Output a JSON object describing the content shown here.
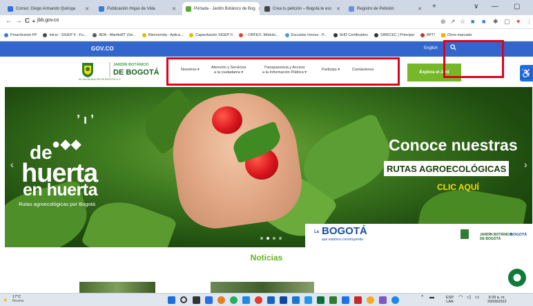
{
  "browser": {
    "tabs": [
      {
        "label": "Correo: Diego Armando Quiroga",
        "color": "#2f6fe0"
      },
      {
        "label": "Publicación Hojas de Vida",
        "color": "#3c7bd6"
      },
      {
        "label": "Portada - Jardín Botánico de Bog",
        "color": "#5ca832"
      },
      {
        "label": "Crea tu petición – Bogotá te esc",
        "color": "#444444"
      },
      {
        "label": "Registro de Petición",
        "color": "#6d8fd9"
      }
    ],
    "new_tab": "+",
    "window_controls": {
      "minimize": "—",
      "maximize": "▢",
      "close": "✕",
      "dropdown": "∨"
    },
    "url": "jbb.gov.co",
    "nav": {
      "back": "←",
      "forward": "→",
      "reload": "C"
    }
  },
  "bookmarks": [
    {
      "label": "Proactivanet FP",
      "color": "#3a7bd5"
    },
    {
      "label": "Inicio - SIGEP II - Fu...",
      "color": "#4a4a4a"
    },
    {
      "label": "ADA - ManttoBT (Ge...",
      "color": "#5a5a5a"
    },
    {
      "label": "Bienvenida - Aplica...",
      "color": "#f0b400"
    },
    {
      "label": "Capacitación SIGEP II",
      "color": "#f0b400"
    },
    {
      "label": ":: ORFEO. Módulo...",
      "color": "#e8452b"
    },
    {
      "label": "Escuelas Innova - P...",
      "color": "#3ea2d8"
    },
    {
      "label": "SHD Certificados",
      "color": "#333333"
    },
    {
      "label": "SIRECEC | Principal",
      "color": "#333333"
    },
    {
      "label": "APTI",
      "color": "#c0392b"
    },
    {
      "label": "Otros marcado",
      "color": "#f0b400"
    }
  ],
  "govbar": {
    "logo": "GOV.CO",
    "language": "English",
    "search_icon": "search-icon"
  },
  "header": {
    "logo_line1": "JARDÍN BOTÁNICO",
    "logo_line2": "DE BOGOTÁ",
    "logo_sub": "ALCALDÍA MAYOR DE BOGOTÁ D.C.",
    "menu": [
      {
        "label": "Nosotros ▾"
      },
      {
        "label": "Atención y Servicios\na la ciudadanía ▾"
      },
      {
        "label": "Transparencia y Acceso\na la Información Pública ▾"
      },
      {
        "label": "Participa ▾"
      },
      {
        "label": "Contáctenos"
      }
    ],
    "explore": "Explora el Jard",
    "accessibility_icon": "♿"
  },
  "hero": {
    "left_line1": "de",
    "left_line2": "huerta",
    "left_line3": "en huerta",
    "left_caption": "Rutas agroecológicas por Bogotá",
    "title": "Conoce nuestras",
    "subtitle": "RUTAS AGROECOLÓGICAS",
    "cta": "CLIC AQUÍ",
    "prev": "‹",
    "next": "›",
    "bogota_logo": "BOGOTÁ",
    "bogota_prefix": "La",
    "bogota_tagline": "que estamos construyendo",
    "footer_logo1": "JARDÍN BOTÁNICO\nDE BOGOTÁ",
    "footer_logo2": "BOGOTÁ"
  },
  "news": {
    "title": "Noticias"
  },
  "taskbar": {
    "weather_temp": "17°C",
    "weather_desc": "Bruma",
    "lang": "ESP\nLAA",
    "time": "9:29 a. m.",
    "date": "29/09/2022"
  }
}
